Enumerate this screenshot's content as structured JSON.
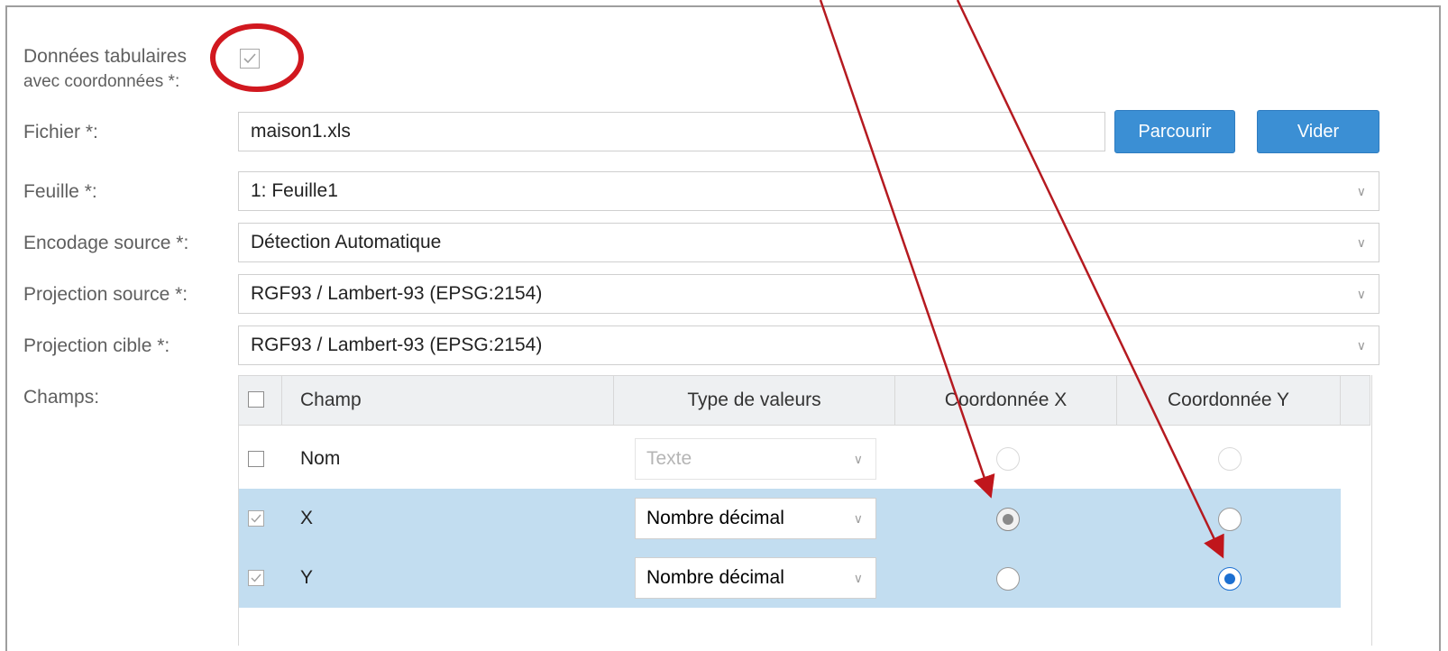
{
  "form": {
    "tabular_label_line1": "Données tabulaires",
    "tabular_label_line2": "avec coordonnées *:",
    "file_label": "Fichier *:",
    "file_value": "maison1.xls",
    "browse_button": "Parcourir",
    "clear_button": "Vider",
    "sheet_label": "Feuille *:",
    "sheet_value": "1: Feuille1",
    "encoding_label": "Encodage source *:",
    "encoding_value": "Détection Automatique",
    "src_proj_label": "Projection source *:",
    "src_proj_value": "RGF93 / Lambert-93 (EPSG:2154)",
    "tgt_proj_label": "Projection cible *:",
    "tgt_proj_value": "RGF93 / Lambert-93 (EPSG:2154)",
    "fields_label": "Champs:"
  },
  "table": {
    "headers": {
      "field": "Champ",
      "type": "Type de valeurs",
      "x": "Coordonnée X",
      "y": "Coordonnée Y"
    },
    "rows": [
      {
        "field": "Nom",
        "type": "Texte",
        "checked": false,
        "x_selected": false,
        "y_selected": false,
        "disabled": true
      },
      {
        "field": "X",
        "type": "Nombre décimal",
        "checked": true,
        "x_selected": true,
        "y_selected": false,
        "disabled": false
      },
      {
        "field": "Y",
        "type": "Nombre décimal",
        "checked": true,
        "x_selected": false,
        "y_selected": true,
        "disabled": false
      }
    ]
  },
  "colors": {
    "button": "#3b8fd4",
    "row_selected": "#c2ddf0",
    "annotation": "#c0161c",
    "radio_selected": "#1b6fd1"
  },
  "icons": [
    "checkmark-icon",
    "chevron-down-icon",
    "radio-icon"
  ]
}
